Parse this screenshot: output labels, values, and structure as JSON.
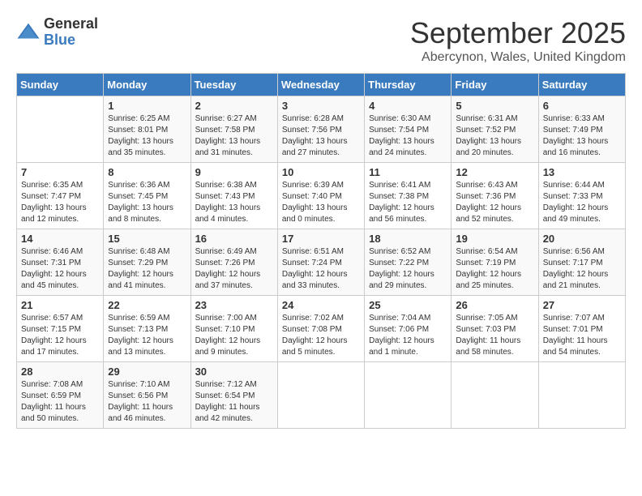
{
  "header": {
    "logo_general": "General",
    "logo_blue": "Blue",
    "month_title": "September 2025",
    "location": "Abercynon, Wales, United Kingdom"
  },
  "days_of_week": [
    "Sunday",
    "Monday",
    "Tuesday",
    "Wednesday",
    "Thursday",
    "Friday",
    "Saturday"
  ],
  "weeks": [
    [
      {
        "day": "",
        "info": ""
      },
      {
        "day": "1",
        "info": "Sunrise: 6:25 AM\nSunset: 8:01 PM\nDaylight: 13 hours\nand 35 minutes."
      },
      {
        "day": "2",
        "info": "Sunrise: 6:27 AM\nSunset: 7:58 PM\nDaylight: 13 hours\nand 31 minutes."
      },
      {
        "day": "3",
        "info": "Sunrise: 6:28 AM\nSunset: 7:56 PM\nDaylight: 13 hours\nand 27 minutes."
      },
      {
        "day": "4",
        "info": "Sunrise: 6:30 AM\nSunset: 7:54 PM\nDaylight: 13 hours\nand 24 minutes."
      },
      {
        "day": "5",
        "info": "Sunrise: 6:31 AM\nSunset: 7:52 PM\nDaylight: 13 hours\nand 20 minutes."
      },
      {
        "day": "6",
        "info": "Sunrise: 6:33 AM\nSunset: 7:49 PM\nDaylight: 13 hours\nand 16 minutes."
      }
    ],
    [
      {
        "day": "7",
        "info": "Sunrise: 6:35 AM\nSunset: 7:47 PM\nDaylight: 13 hours\nand 12 minutes."
      },
      {
        "day": "8",
        "info": "Sunrise: 6:36 AM\nSunset: 7:45 PM\nDaylight: 13 hours\nand 8 minutes."
      },
      {
        "day": "9",
        "info": "Sunrise: 6:38 AM\nSunset: 7:43 PM\nDaylight: 13 hours\nand 4 minutes."
      },
      {
        "day": "10",
        "info": "Sunrise: 6:39 AM\nSunset: 7:40 PM\nDaylight: 13 hours\nand 0 minutes."
      },
      {
        "day": "11",
        "info": "Sunrise: 6:41 AM\nSunset: 7:38 PM\nDaylight: 12 hours\nand 56 minutes."
      },
      {
        "day": "12",
        "info": "Sunrise: 6:43 AM\nSunset: 7:36 PM\nDaylight: 12 hours\nand 52 minutes."
      },
      {
        "day": "13",
        "info": "Sunrise: 6:44 AM\nSunset: 7:33 PM\nDaylight: 12 hours\nand 49 minutes."
      }
    ],
    [
      {
        "day": "14",
        "info": "Sunrise: 6:46 AM\nSunset: 7:31 PM\nDaylight: 12 hours\nand 45 minutes."
      },
      {
        "day": "15",
        "info": "Sunrise: 6:48 AM\nSunset: 7:29 PM\nDaylight: 12 hours\nand 41 minutes."
      },
      {
        "day": "16",
        "info": "Sunrise: 6:49 AM\nSunset: 7:26 PM\nDaylight: 12 hours\nand 37 minutes."
      },
      {
        "day": "17",
        "info": "Sunrise: 6:51 AM\nSunset: 7:24 PM\nDaylight: 12 hours\nand 33 minutes."
      },
      {
        "day": "18",
        "info": "Sunrise: 6:52 AM\nSunset: 7:22 PM\nDaylight: 12 hours\nand 29 minutes."
      },
      {
        "day": "19",
        "info": "Sunrise: 6:54 AM\nSunset: 7:19 PM\nDaylight: 12 hours\nand 25 minutes."
      },
      {
        "day": "20",
        "info": "Sunrise: 6:56 AM\nSunset: 7:17 PM\nDaylight: 12 hours\nand 21 minutes."
      }
    ],
    [
      {
        "day": "21",
        "info": "Sunrise: 6:57 AM\nSunset: 7:15 PM\nDaylight: 12 hours\nand 17 minutes."
      },
      {
        "day": "22",
        "info": "Sunrise: 6:59 AM\nSunset: 7:13 PM\nDaylight: 12 hours\nand 13 minutes."
      },
      {
        "day": "23",
        "info": "Sunrise: 7:00 AM\nSunset: 7:10 PM\nDaylight: 12 hours\nand 9 minutes."
      },
      {
        "day": "24",
        "info": "Sunrise: 7:02 AM\nSunset: 7:08 PM\nDaylight: 12 hours\nand 5 minutes."
      },
      {
        "day": "25",
        "info": "Sunrise: 7:04 AM\nSunset: 7:06 PM\nDaylight: 12 hours\nand 1 minute."
      },
      {
        "day": "26",
        "info": "Sunrise: 7:05 AM\nSunset: 7:03 PM\nDaylight: 11 hours\nand 58 minutes."
      },
      {
        "day": "27",
        "info": "Sunrise: 7:07 AM\nSunset: 7:01 PM\nDaylight: 11 hours\nand 54 minutes."
      }
    ],
    [
      {
        "day": "28",
        "info": "Sunrise: 7:08 AM\nSunset: 6:59 PM\nDaylight: 11 hours\nand 50 minutes."
      },
      {
        "day": "29",
        "info": "Sunrise: 7:10 AM\nSunset: 6:56 PM\nDaylight: 11 hours\nand 46 minutes."
      },
      {
        "day": "30",
        "info": "Sunrise: 7:12 AM\nSunset: 6:54 PM\nDaylight: 11 hours\nand 42 minutes."
      },
      {
        "day": "",
        "info": ""
      },
      {
        "day": "",
        "info": ""
      },
      {
        "day": "",
        "info": ""
      },
      {
        "day": "",
        "info": ""
      }
    ]
  ]
}
